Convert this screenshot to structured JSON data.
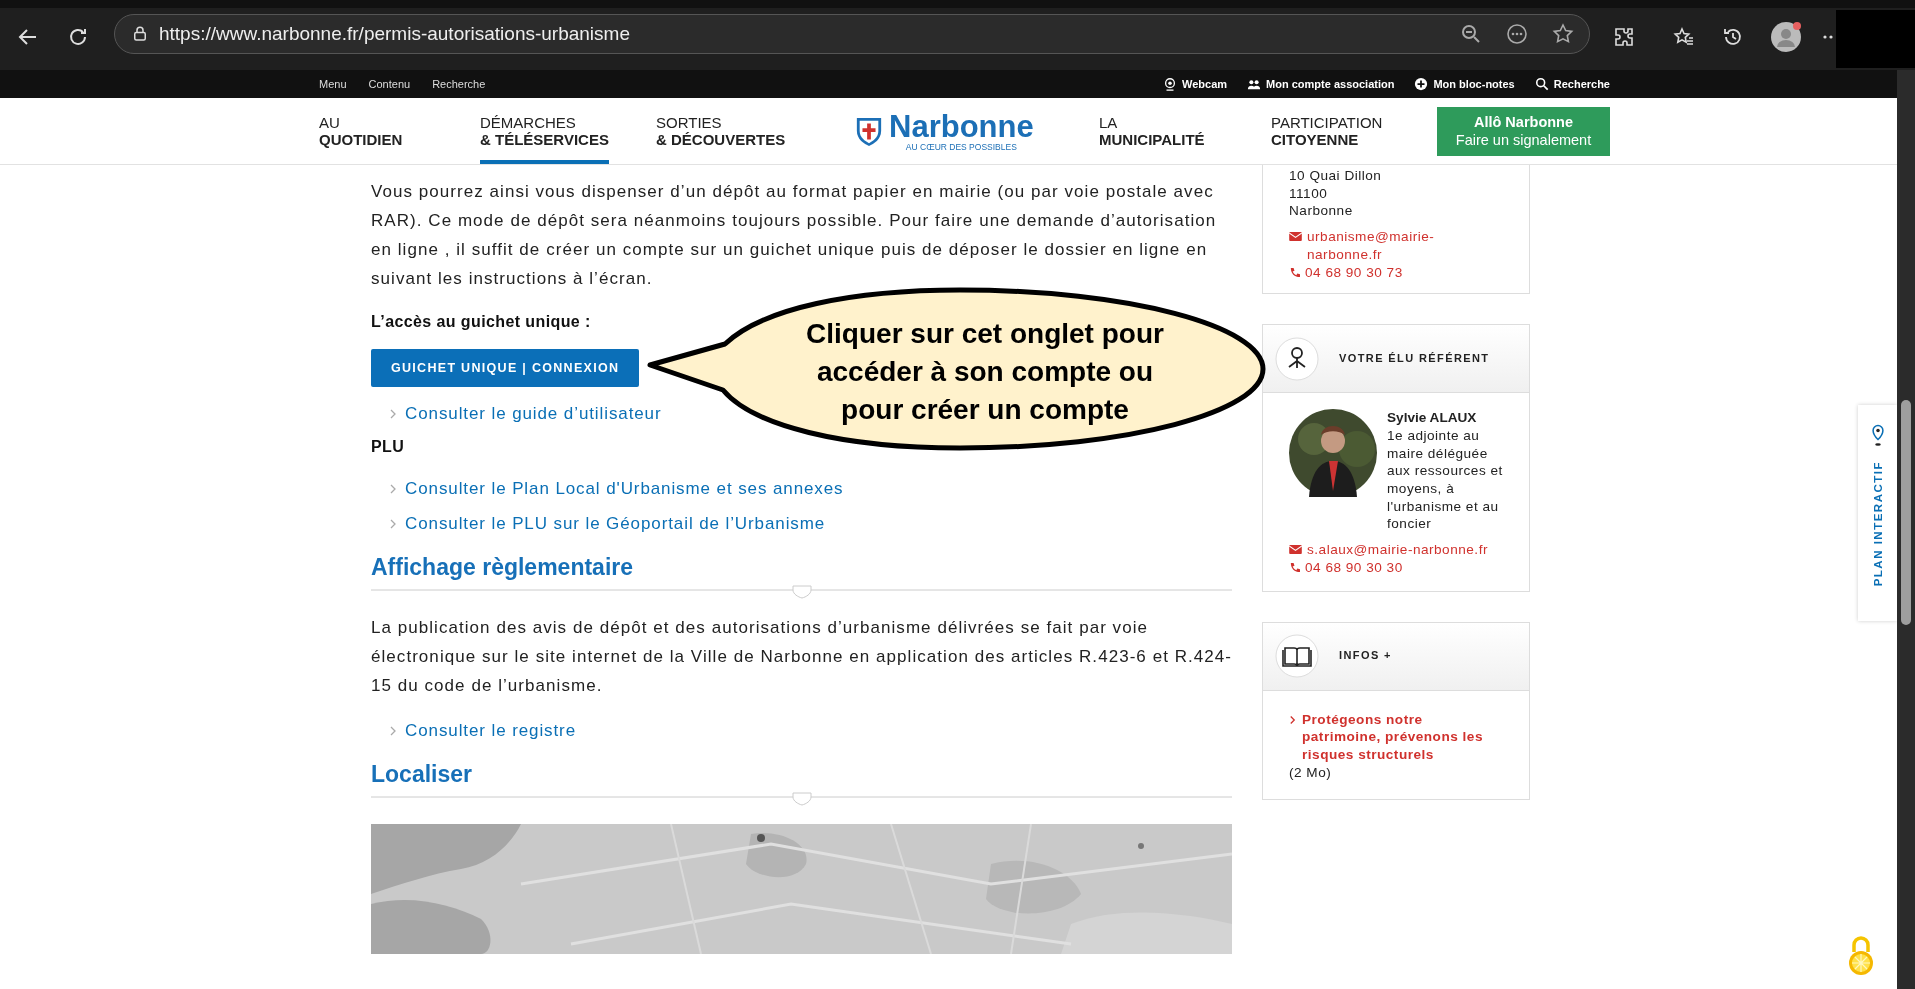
{
  "browser": {
    "url": "https://www.narbonne.fr/permis-autorisations-urbanisme"
  },
  "top_bar": {
    "left_links": [
      "Menu",
      "Contenu",
      "Recherche"
    ],
    "right_links": [
      {
        "kind": "webcam",
        "label": "Webcam"
      },
      {
        "kind": "association",
        "label": "Mon compte association"
      },
      {
        "kind": "notes",
        "label": "Mon bloc-notes"
      },
      {
        "kind": "search",
        "label": "Recherche"
      }
    ]
  },
  "nav": {
    "left": [
      {
        "line1": "AU",
        "line2": "QUOTIDIEN",
        "selected": false
      },
      {
        "line1": "DÉMARCHES",
        "line2": "& TÉLÉSERVICES",
        "selected": true
      },
      {
        "line1": "SORTIES",
        "line2": "& DÉCOUVERTES",
        "selected": false
      }
    ],
    "logo": {
      "name": "Narbonne",
      "tagline": "AU CŒUR DES POSSIBLES"
    },
    "right": [
      {
        "line1": "LA",
        "line2": "MUNICIPALITÉ",
        "selected": false
      },
      {
        "line1": "PARTICIPATION",
        "line2": "CITOYENNE",
        "selected": false
      }
    ],
    "cta": {
      "title": "Allô Narbonne",
      "subtitle": "Faire un signalement"
    }
  },
  "content": [
    {
      "kind": "paragraph",
      "text": "Vous pourrez ainsi vous dispenser d’un dépôt au format papier en mairie (ou par voie postale avec RAR). Ce mode de dépôt sera néanmoins toujours possible. Pour faire une demande d’autorisation en ligne , il suffit de créer un compte sur un guichet unique puis de déposer le dossier en ligne en suivant les instructions à l’écran."
    },
    {
      "kind": "label",
      "text": "L’accès au guichet unique :"
    },
    {
      "kind": "button",
      "text": "GUICHET UNIQUE | CONNEXION"
    },
    {
      "kind": "link",
      "text": "Consulter le guide d’utilisateur"
    },
    {
      "kind": "label",
      "text": "PLU"
    },
    {
      "kind": "link",
      "text": "Consulter le Plan Local d'Urbanisme et ses annexes"
    },
    {
      "kind": "link",
      "text": "Consulter le PLU sur le Géoportail de l’Urbanisme"
    },
    {
      "kind": "heading",
      "text": "Affichage règlementaire"
    },
    {
      "kind": "paragraph",
      "text": "La publication des avis de dépôt et des autorisations d’urbanisme délivrées se fait par voie électronique sur le site internet de la Ville de Narbonne en application des articles R.423-6 et R.424-15 du code de l’urbanisme."
    },
    {
      "kind": "link",
      "text": "Consulter le registre"
    },
    {
      "kind": "heading",
      "text": "Localiser"
    },
    {
      "kind": "map"
    }
  ],
  "callout": {
    "lines": [
      "Cliquer sur cet onglet pour",
      "accéder à son compte ou",
      "pour créer un compte"
    ]
  },
  "sidebar": {
    "contact": {
      "address": [
        "10 Quai Dillon",
        "11100",
        "Narbonne"
      ],
      "email": "urbanisme@mairie-narbonne.fr",
      "phone": "04 68 90 30 73"
    },
    "elected": {
      "title": "VOTRE ÉLU RÉFÉRENT",
      "name": "Sylvie ALAUX",
      "role": "1e adjointe au maire déléguée aux ressources et moyens, à l'urbanisme et au foncier",
      "email": "s.alaux@mairie-narbonne.fr",
      "phone": "04 68 90 30 30"
    },
    "infos": {
      "title": "INFOS +",
      "link": "Protégeons notre patrimoine, prévenons les risques structurels",
      "note": "(2 Mo)"
    }
  },
  "side_tab": {
    "label": "PLAN INTERACTIF"
  }
}
